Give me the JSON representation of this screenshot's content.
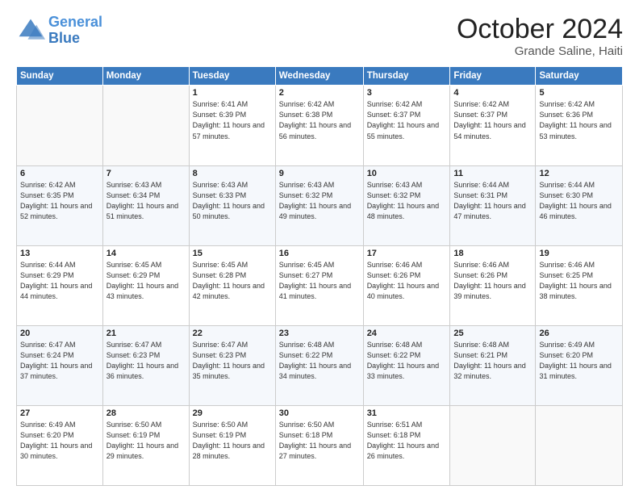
{
  "logo": {
    "line1": "General",
    "line2": "Blue"
  },
  "header": {
    "month": "October 2024",
    "location": "Grande Saline, Haiti"
  },
  "days_of_week": [
    "Sunday",
    "Monday",
    "Tuesday",
    "Wednesday",
    "Thursday",
    "Friday",
    "Saturday"
  ],
  "weeks": [
    [
      {
        "day": "",
        "sunrise": "",
        "sunset": "",
        "daylight": ""
      },
      {
        "day": "",
        "sunrise": "",
        "sunset": "",
        "daylight": ""
      },
      {
        "day": "1",
        "sunrise": "Sunrise: 6:41 AM",
        "sunset": "Sunset: 6:39 PM",
        "daylight": "Daylight: 11 hours and 57 minutes."
      },
      {
        "day": "2",
        "sunrise": "Sunrise: 6:42 AM",
        "sunset": "Sunset: 6:38 PM",
        "daylight": "Daylight: 11 hours and 56 minutes."
      },
      {
        "day": "3",
        "sunrise": "Sunrise: 6:42 AM",
        "sunset": "Sunset: 6:37 PM",
        "daylight": "Daylight: 11 hours and 55 minutes."
      },
      {
        "day": "4",
        "sunrise": "Sunrise: 6:42 AM",
        "sunset": "Sunset: 6:37 PM",
        "daylight": "Daylight: 11 hours and 54 minutes."
      },
      {
        "day": "5",
        "sunrise": "Sunrise: 6:42 AM",
        "sunset": "Sunset: 6:36 PM",
        "daylight": "Daylight: 11 hours and 53 minutes."
      }
    ],
    [
      {
        "day": "6",
        "sunrise": "Sunrise: 6:42 AM",
        "sunset": "Sunset: 6:35 PM",
        "daylight": "Daylight: 11 hours and 52 minutes."
      },
      {
        "day": "7",
        "sunrise": "Sunrise: 6:43 AM",
        "sunset": "Sunset: 6:34 PM",
        "daylight": "Daylight: 11 hours and 51 minutes."
      },
      {
        "day": "8",
        "sunrise": "Sunrise: 6:43 AM",
        "sunset": "Sunset: 6:33 PM",
        "daylight": "Daylight: 11 hours and 50 minutes."
      },
      {
        "day": "9",
        "sunrise": "Sunrise: 6:43 AM",
        "sunset": "Sunset: 6:32 PM",
        "daylight": "Daylight: 11 hours and 49 minutes."
      },
      {
        "day": "10",
        "sunrise": "Sunrise: 6:43 AM",
        "sunset": "Sunset: 6:32 PM",
        "daylight": "Daylight: 11 hours and 48 minutes."
      },
      {
        "day": "11",
        "sunrise": "Sunrise: 6:44 AM",
        "sunset": "Sunset: 6:31 PM",
        "daylight": "Daylight: 11 hours and 47 minutes."
      },
      {
        "day": "12",
        "sunrise": "Sunrise: 6:44 AM",
        "sunset": "Sunset: 6:30 PM",
        "daylight": "Daylight: 11 hours and 46 minutes."
      }
    ],
    [
      {
        "day": "13",
        "sunrise": "Sunrise: 6:44 AM",
        "sunset": "Sunset: 6:29 PM",
        "daylight": "Daylight: 11 hours and 44 minutes."
      },
      {
        "day": "14",
        "sunrise": "Sunrise: 6:45 AM",
        "sunset": "Sunset: 6:29 PM",
        "daylight": "Daylight: 11 hours and 43 minutes."
      },
      {
        "day": "15",
        "sunrise": "Sunrise: 6:45 AM",
        "sunset": "Sunset: 6:28 PM",
        "daylight": "Daylight: 11 hours and 42 minutes."
      },
      {
        "day": "16",
        "sunrise": "Sunrise: 6:45 AM",
        "sunset": "Sunset: 6:27 PM",
        "daylight": "Daylight: 11 hours and 41 minutes."
      },
      {
        "day": "17",
        "sunrise": "Sunrise: 6:46 AM",
        "sunset": "Sunset: 6:26 PM",
        "daylight": "Daylight: 11 hours and 40 minutes."
      },
      {
        "day": "18",
        "sunrise": "Sunrise: 6:46 AM",
        "sunset": "Sunset: 6:26 PM",
        "daylight": "Daylight: 11 hours and 39 minutes."
      },
      {
        "day": "19",
        "sunrise": "Sunrise: 6:46 AM",
        "sunset": "Sunset: 6:25 PM",
        "daylight": "Daylight: 11 hours and 38 minutes."
      }
    ],
    [
      {
        "day": "20",
        "sunrise": "Sunrise: 6:47 AM",
        "sunset": "Sunset: 6:24 PM",
        "daylight": "Daylight: 11 hours and 37 minutes."
      },
      {
        "day": "21",
        "sunrise": "Sunrise: 6:47 AM",
        "sunset": "Sunset: 6:23 PM",
        "daylight": "Daylight: 11 hours and 36 minutes."
      },
      {
        "day": "22",
        "sunrise": "Sunrise: 6:47 AM",
        "sunset": "Sunset: 6:23 PM",
        "daylight": "Daylight: 11 hours and 35 minutes."
      },
      {
        "day": "23",
        "sunrise": "Sunrise: 6:48 AM",
        "sunset": "Sunset: 6:22 PM",
        "daylight": "Daylight: 11 hours and 34 minutes."
      },
      {
        "day": "24",
        "sunrise": "Sunrise: 6:48 AM",
        "sunset": "Sunset: 6:22 PM",
        "daylight": "Daylight: 11 hours and 33 minutes."
      },
      {
        "day": "25",
        "sunrise": "Sunrise: 6:48 AM",
        "sunset": "Sunset: 6:21 PM",
        "daylight": "Daylight: 11 hours and 32 minutes."
      },
      {
        "day": "26",
        "sunrise": "Sunrise: 6:49 AM",
        "sunset": "Sunset: 6:20 PM",
        "daylight": "Daylight: 11 hours and 31 minutes."
      }
    ],
    [
      {
        "day": "27",
        "sunrise": "Sunrise: 6:49 AM",
        "sunset": "Sunset: 6:20 PM",
        "daylight": "Daylight: 11 hours and 30 minutes."
      },
      {
        "day": "28",
        "sunrise": "Sunrise: 6:50 AM",
        "sunset": "Sunset: 6:19 PM",
        "daylight": "Daylight: 11 hours and 29 minutes."
      },
      {
        "day": "29",
        "sunrise": "Sunrise: 6:50 AM",
        "sunset": "Sunset: 6:19 PM",
        "daylight": "Daylight: 11 hours and 28 minutes."
      },
      {
        "day": "30",
        "sunrise": "Sunrise: 6:50 AM",
        "sunset": "Sunset: 6:18 PM",
        "daylight": "Daylight: 11 hours and 27 minutes."
      },
      {
        "day": "31",
        "sunrise": "Sunrise: 6:51 AM",
        "sunset": "Sunset: 6:18 PM",
        "daylight": "Daylight: 11 hours and 26 minutes."
      },
      {
        "day": "",
        "sunrise": "",
        "sunset": "",
        "daylight": ""
      },
      {
        "day": "",
        "sunrise": "",
        "sunset": "",
        "daylight": ""
      }
    ]
  ]
}
